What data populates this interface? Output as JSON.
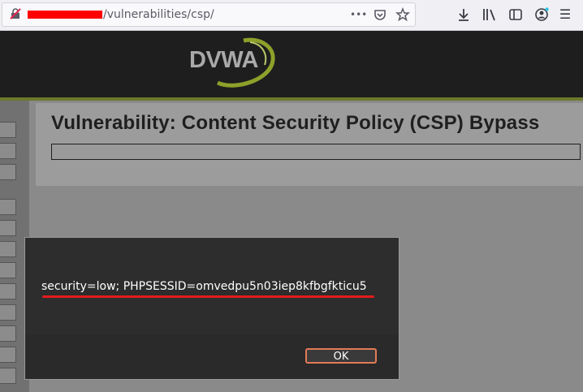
{
  "browser": {
    "url_path": "/vulnerabilities/csp/",
    "icons": [
      "insecure-lock-icon",
      "page-actions-icon",
      "pocket-icon",
      "bookmark-star-icon",
      "downloads-icon",
      "library-icon",
      "sidebar-icon",
      "account-icon",
      "menu-icon"
    ],
    "page_actions_glyph": "•••",
    "menu_glyph": "☰"
  },
  "header": {
    "logo_text": "DVWA",
    "accent_color": "#6c7a2c"
  },
  "page": {
    "title": "Vulnerability: Content Security Policy (CSP) Bypass"
  },
  "dialog": {
    "message": "security=low; PHPSESSID=omvedpu5n03iep8kfbgfkticu5",
    "ok_label": "OK",
    "highlight_color": "#e31b1b"
  }
}
